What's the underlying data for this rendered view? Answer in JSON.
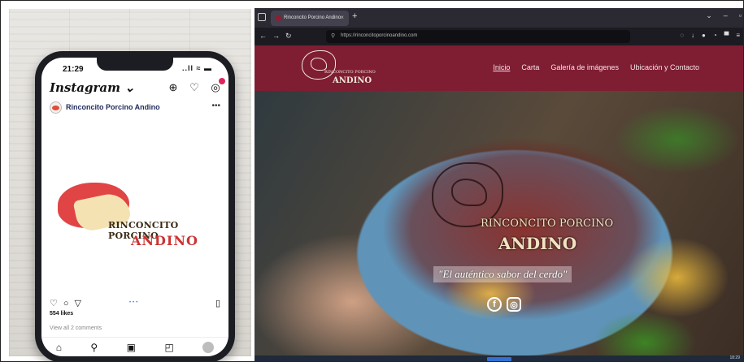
{
  "phone": {
    "status": {
      "time": "21:29",
      "signal": "..ll ≈ ▬"
    },
    "app": {
      "name": "Instagram ⌄"
    },
    "post": {
      "account": "Rinconcito Porcino Andino",
      "image_text_line1": "RINCONCITO PORCINO",
      "image_text_line2": "ANDINO",
      "likes": "554 likes",
      "comments": "View all 2 comments"
    }
  },
  "browser": {
    "tab": {
      "title": "Rinconcito Porcino Andino"
    },
    "url": "https://rinconcitoporcinoandino.com",
    "site": {
      "header_name_small": "RINCONCITO PORCINO",
      "header_name_big": "ANDINO",
      "menu": [
        "Inicio",
        "Carta",
        "Galería de imágenes",
        "Ubicación y Contacto"
      ],
      "hero_name_line1": "RINCONCITO PORCINO",
      "hero_name_line2": "ANDINO",
      "tagline": "\"El auténtico sabor del cerdo\""
    },
    "taskbar_clock": "18:29"
  },
  "colors": {
    "brand": "#7f1d33",
    "logo_red": "#e04444",
    "logo_text_red": "#cc3333"
  }
}
